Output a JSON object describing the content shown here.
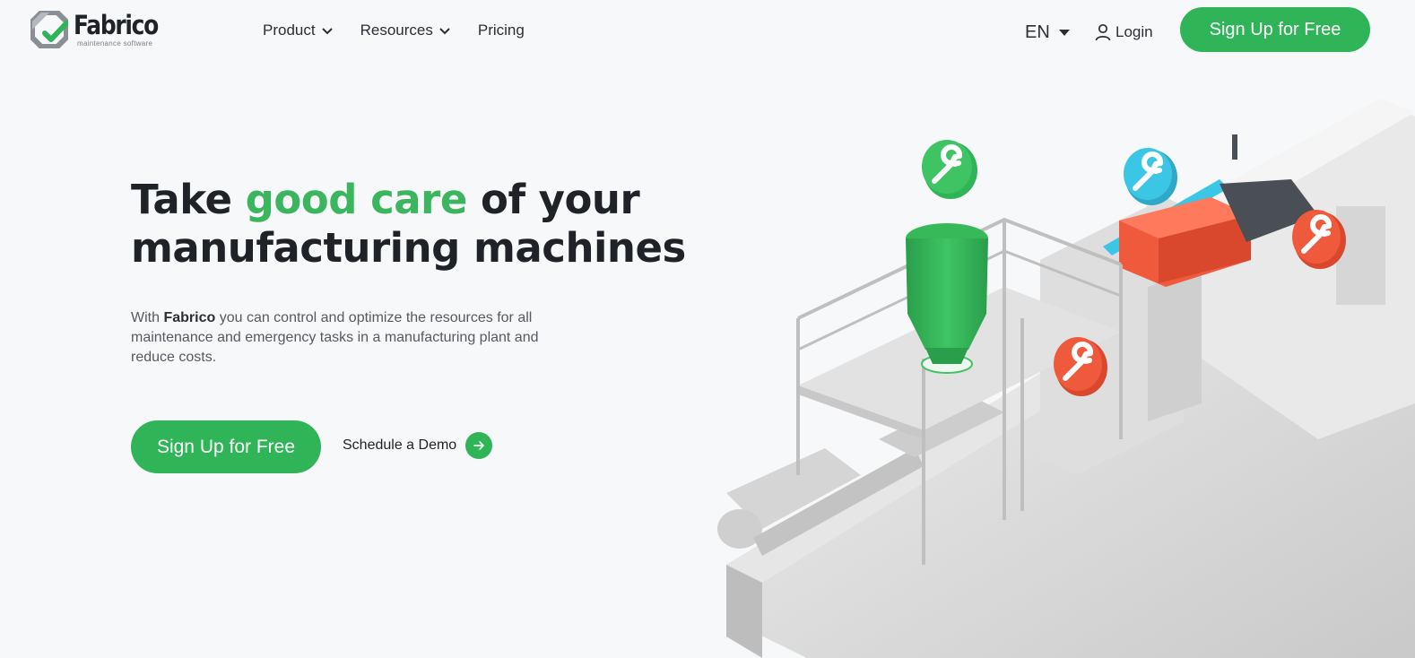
{
  "header": {
    "logo_name": "Fabrico",
    "logo_tagline": "maintenance software",
    "nav": [
      {
        "label": "Product",
        "dropdown": true
      },
      {
        "label": "Resources",
        "dropdown": true
      },
      {
        "label": "Pricing",
        "dropdown": false
      }
    ],
    "language": "EN",
    "login_label": "Login",
    "signup_label": "Sign Up for Free"
  },
  "hero": {
    "title_part1": "Take ",
    "title_accent": "good care",
    "title_part2": " of your manufacturing machines",
    "desc_prefix": "With ",
    "desc_brand": "Fabrico",
    "desc_rest": " you can control and optimize the resources for all maintenance and emergency tasks in a manufacturing plant and reduce costs.",
    "cta_primary": "Sign Up for Free",
    "cta_secondary": "Schedule a Demo"
  },
  "icons": {
    "chevron": "chevron-down-icon",
    "caret": "caret-down-icon",
    "user": "user-icon",
    "arrow": "arrow-right-icon",
    "wrench": "wrench-icon"
  },
  "colors": {
    "brand_green": "#2fb457",
    "accent_text": "#3cb55f",
    "wrench_red": "#f05a3c",
    "wrench_blue": "#3cc6e6",
    "background": "#f7f8fa"
  }
}
